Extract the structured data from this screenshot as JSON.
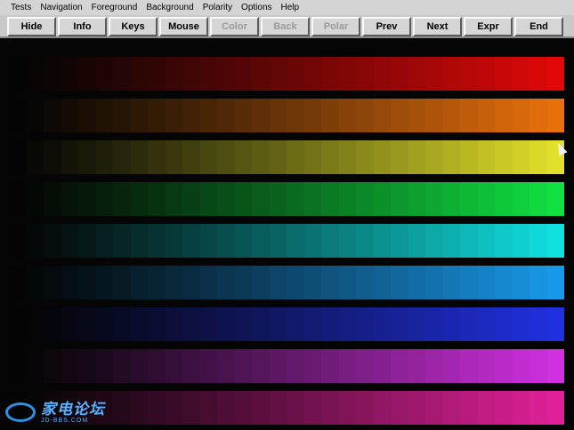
{
  "menu": {
    "items": [
      {
        "label": "Tests"
      },
      {
        "label": "Navigation"
      },
      {
        "label": "Foreground"
      },
      {
        "label": "Background"
      },
      {
        "label": "Polarity"
      },
      {
        "label": "Options"
      },
      {
        "label": "Help"
      }
    ]
  },
  "toolbar": {
    "buttons": [
      {
        "label": "Hide",
        "enabled": true
      },
      {
        "label": "Info",
        "enabled": true
      },
      {
        "label": "Keys",
        "enabled": true
      },
      {
        "label": "Mouse",
        "enabled": true
      },
      {
        "label": "Color",
        "enabled": false
      },
      {
        "label": "Back",
        "enabled": false
      },
      {
        "label": "Polar",
        "enabled": false
      },
      {
        "label": "Prev",
        "enabled": true
      },
      {
        "label": "Next",
        "enabled": true
      },
      {
        "label": "Expr",
        "enabled": true
      },
      {
        "label": "End",
        "enabled": true
      }
    ]
  },
  "pattern": {
    "steps": 32,
    "colors": [
      "#e00808",
      "#e8700c",
      "#e2e02a",
      "#10e040",
      "#10e0e0",
      "#1898e8",
      "#2030e0",
      "#d030e0",
      "#e02098"
    ]
  },
  "watermark": {
    "title": "家电论坛",
    "subtitle": "JD-BBS.COM"
  }
}
